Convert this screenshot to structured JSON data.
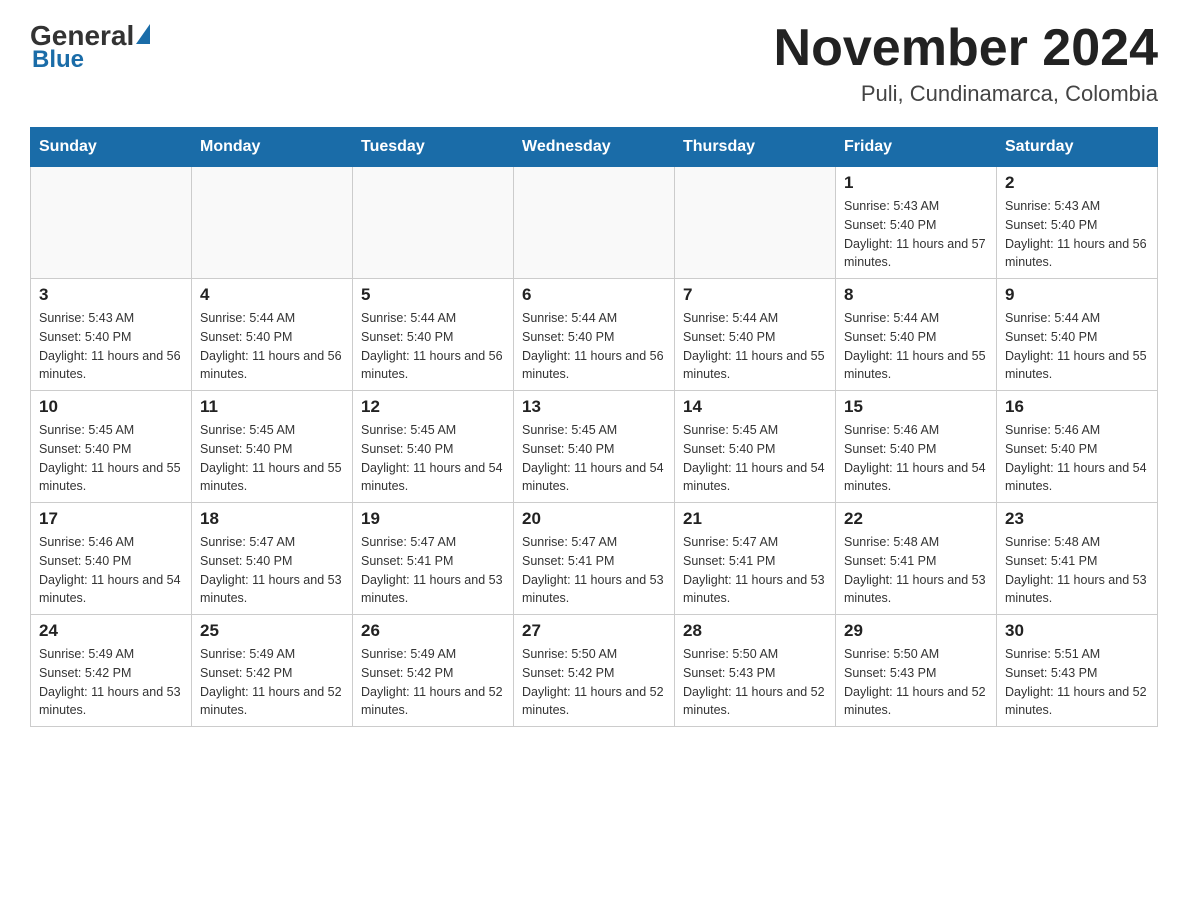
{
  "logo": {
    "general": "General",
    "blue": "Blue"
  },
  "title": {
    "month_year": "November 2024",
    "location": "Puli, Cundinamarca, Colombia"
  },
  "weekdays": [
    "Sunday",
    "Monday",
    "Tuesday",
    "Wednesday",
    "Thursday",
    "Friday",
    "Saturday"
  ],
  "weeks": [
    [
      {
        "day": "",
        "info": ""
      },
      {
        "day": "",
        "info": ""
      },
      {
        "day": "",
        "info": ""
      },
      {
        "day": "",
        "info": ""
      },
      {
        "day": "",
        "info": ""
      },
      {
        "day": "1",
        "info": "Sunrise: 5:43 AM\nSunset: 5:40 PM\nDaylight: 11 hours and 57 minutes."
      },
      {
        "day": "2",
        "info": "Sunrise: 5:43 AM\nSunset: 5:40 PM\nDaylight: 11 hours and 56 minutes."
      }
    ],
    [
      {
        "day": "3",
        "info": "Sunrise: 5:43 AM\nSunset: 5:40 PM\nDaylight: 11 hours and 56 minutes."
      },
      {
        "day": "4",
        "info": "Sunrise: 5:44 AM\nSunset: 5:40 PM\nDaylight: 11 hours and 56 minutes."
      },
      {
        "day": "5",
        "info": "Sunrise: 5:44 AM\nSunset: 5:40 PM\nDaylight: 11 hours and 56 minutes."
      },
      {
        "day": "6",
        "info": "Sunrise: 5:44 AM\nSunset: 5:40 PM\nDaylight: 11 hours and 56 minutes."
      },
      {
        "day": "7",
        "info": "Sunrise: 5:44 AM\nSunset: 5:40 PM\nDaylight: 11 hours and 55 minutes."
      },
      {
        "day": "8",
        "info": "Sunrise: 5:44 AM\nSunset: 5:40 PM\nDaylight: 11 hours and 55 minutes."
      },
      {
        "day": "9",
        "info": "Sunrise: 5:44 AM\nSunset: 5:40 PM\nDaylight: 11 hours and 55 minutes."
      }
    ],
    [
      {
        "day": "10",
        "info": "Sunrise: 5:45 AM\nSunset: 5:40 PM\nDaylight: 11 hours and 55 minutes."
      },
      {
        "day": "11",
        "info": "Sunrise: 5:45 AM\nSunset: 5:40 PM\nDaylight: 11 hours and 55 minutes."
      },
      {
        "day": "12",
        "info": "Sunrise: 5:45 AM\nSunset: 5:40 PM\nDaylight: 11 hours and 54 minutes."
      },
      {
        "day": "13",
        "info": "Sunrise: 5:45 AM\nSunset: 5:40 PM\nDaylight: 11 hours and 54 minutes."
      },
      {
        "day": "14",
        "info": "Sunrise: 5:45 AM\nSunset: 5:40 PM\nDaylight: 11 hours and 54 minutes."
      },
      {
        "day": "15",
        "info": "Sunrise: 5:46 AM\nSunset: 5:40 PM\nDaylight: 11 hours and 54 minutes."
      },
      {
        "day": "16",
        "info": "Sunrise: 5:46 AM\nSunset: 5:40 PM\nDaylight: 11 hours and 54 minutes."
      }
    ],
    [
      {
        "day": "17",
        "info": "Sunrise: 5:46 AM\nSunset: 5:40 PM\nDaylight: 11 hours and 54 minutes."
      },
      {
        "day": "18",
        "info": "Sunrise: 5:47 AM\nSunset: 5:40 PM\nDaylight: 11 hours and 53 minutes."
      },
      {
        "day": "19",
        "info": "Sunrise: 5:47 AM\nSunset: 5:41 PM\nDaylight: 11 hours and 53 minutes."
      },
      {
        "day": "20",
        "info": "Sunrise: 5:47 AM\nSunset: 5:41 PM\nDaylight: 11 hours and 53 minutes."
      },
      {
        "day": "21",
        "info": "Sunrise: 5:47 AM\nSunset: 5:41 PM\nDaylight: 11 hours and 53 minutes."
      },
      {
        "day": "22",
        "info": "Sunrise: 5:48 AM\nSunset: 5:41 PM\nDaylight: 11 hours and 53 minutes."
      },
      {
        "day": "23",
        "info": "Sunrise: 5:48 AM\nSunset: 5:41 PM\nDaylight: 11 hours and 53 minutes."
      }
    ],
    [
      {
        "day": "24",
        "info": "Sunrise: 5:49 AM\nSunset: 5:42 PM\nDaylight: 11 hours and 53 minutes."
      },
      {
        "day": "25",
        "info": "Sunrise: 5:49 AM\nSunset: 5:42 PM\nDaylight: 11 hours and 52 minutes."
      },
      {
        "day": "26",
        "info": "Sunrise: 5:49 AM\nSunset: 5:42 PM\nDaylight: 11 hours and 52 minutes."
      },
      {
        "day": "27",
        "info": "Sunrise: 5:50 AM\nSunset: 5:42 PM\nDaylight: 11 hours and 52 minutes."
      },
      {
        "day": "28",
        "info": "Sunrise: 5:50 AM\nSunset: 5:43 PM\nDaylight: 11 hours and 52 minutes."
      },
      {
        "day": "29",
        "info": "Sunrise: 5:50 AM\nSunset: 5:43 PM\nDaylight: 11 hours and 52 minutes."
      },
      {
        "day": "30",
        "info": "Sunrise: 5:51 AM\nSunset: 5:43 PM\nDaylight: 11 hours and 52 minutes."
      }
    ]
  ]
}
